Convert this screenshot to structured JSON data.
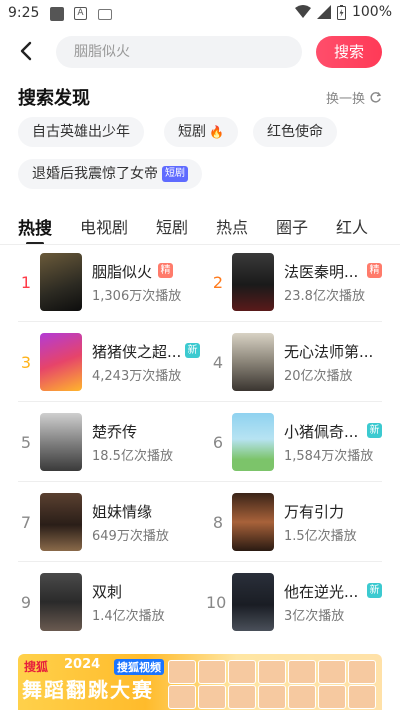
{
  "status_bar": {
    "time": "9:25",
    "battery": "100%"
  },
  "search": {
    "placeholder": "胭脂似火",
    "button_label": "搜索"
  },
  "discovery": {
    "title": "搜索发现",
    "refresh_label": "换一换",
    "chips": [
      {
        "label": "自古英雄出少年"
      },
      {
        "label": "短剧",
        "icon": "flame-icon"
      },
      {
        "label": "红色使命"
      },
      {
        "label": "退婚后我震惊了女帝",
        "tag": "短剧"
      }
    ]
  },
  "tabs": [
    {
      "label": "热搜",
      "active": true
    },
    {
      "label": "电视剧"
    },
    {
      "label": "短剧"
    },
    {
      "label": "热点"
    },
    {
      "label": "圈子"
    },
    {
      "label": "红人"
    }
  ],
  "ranking": [
    {
      "rank": "1",
      "title": "胭脂似火",
      "plays": "1,306万次播放",
      "badge": "精"
    },
    {
      "rank": "2",
      "title": "法医秦明...",
      "plays": "23.8亿次播放",
      "badge": "精"
    },
    {
      "rank": "3",
      "title": "猪猪侠之超...",
      "plays": "4,243万次播放",
      "badge": "新"
    },
    {
      "rank": "4",
      "title": "无心法师第...",
      "plays": "20亿次播放",
      "badge": ""
    },
    {
      "rank": "5",
      "title": "楚乔传",
      "plays": "18.5亿次播放",
      "badge": ""
    },
    {
      "rank": "6",
      "title": "小猪佩奇...",
      "plays": "1,584万次播放",
      "badge": "新"
    },
    {
      "rank": "7",
      "title": "姐妹情缘",
      "plays": "649万次播放",
      "badge": ""
    },
    {
      "rank": "8",
      "title": "万有引力",
      "plays": "1.5亿次播放",
      "badge": ""
    },
    {
      "rank": "9",
      "title": "双刺",
      "plays": "1.4亿次播放",
      "badge": ""
    },
    {
      "rank": "10",
      "title": "他在逆光...",
      "plays": "3亿次播放",
      "badge": "新"
    }
  ],
  "banner": {
    "logo": "搜狐",
    "year": "2024",
    "sub": "搜狐视频",
    "headline": "舞蹈翻跳大赛"
  },
  "colors": {
    "accent": "#ff3a57",
    "hot_badge": "#ff7b6b",
    "new_badge": "#3ccad0",
    "tag": "#5f6bff"
  }
}
